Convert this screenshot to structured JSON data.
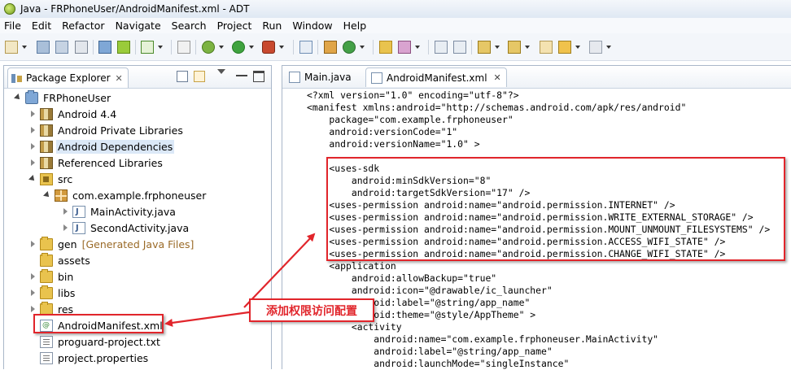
{
  "window": {
    "title": "Java - FRPhoneUser/AndroidManifest.xml - ADT"
  },
  "menu": [
    "File",
    "Edit",
    "Refactor",
    "Navigate",
    "Search",
    "Project",
    "Run",
    "Window",
    "Help"
  ],
  "package_explorer": {
    "tab_label": "Package Explorer",
    "close_glyph": "✕",
    "items": [
      {
        "label": "FRPhoneUser"
      },
      {
        "label": "Android 4.4"
      },
      {
        "label": "Android Private Libraries"
      },
      {
        "label": "Android Dependencies"
      },
      {
        "label": "Referenced Libraries"
      },
      {
        "label": "src"
      },
      {
        "label": "com.example.frphoneuser"
      },
      {
        "label": "MainActivity.java"
      },
      {
        "label": "SecondActivity.java"
      },
      {
        "label": "gen",
        "decoration": "[Generated Java Files]"
      },
      {
        "label": "assets"
      },
      {
        "label": "bin"
      },
      {
        "label": "libs"
      },
      {
        "label": "res"
      },
      {
        "label": "AndroidManifest.xml"
      },
      {
        "label": "proguard-project.txt"
      },
      {
        "label": "project.properties"
      }
    ]
  },
  "editor": {
    "tabs": [
      {
        "label": "Main.java"
      },
      {
        "label": "AndroidManifest.xml",
        "close": "✕"
      }
    ],
    "lines": [
      "<?xml version=\"1.0\" encoding=\"utf-8\"?>",
      "<manifest xmlns:android=\"http://schemas.android.com/apk/res/android\"",
      "    package=\"com.example.frphoneuser\"",
      "    android:versionCode=\"1\"",
      "    android:versionName=\"1.0\" >",
      "",
      "    <uses-sdk",
      "        android:minSdkVersion=\"8\"",
      "        android:targetSdkVersion=\"17\" />",
      "    <uses-permission android:name=\"android.permission.INTERNET\" />",
      "    <uses-permission android:name=\"android.permission.WRITE_EXTERNAL_STORAGE\" />",
      "    <uses-permission android:name=\"android.permission.MOUNT_UNMOUNT_FILESYSTEMS\" />",
      "    <uses-permission android:name=\"android.permission.ACCESS_WIFI_STATE\" />",
      "    <uses-permission android:name=\"android.permission.CHANGE_WIFI_STATE\" />",
      "    <application",
      "        android:allowBackup=\"true\"",
      "        android:icon=\"@drawable/ic_launcher\"",
      "        android:label=\"@string/app_name\"",
      "        android:theme=\"@style/AppTheme\" >",
      "        <activity",
      "            android:name=\"com.example.frphoneuser.MainActivity\"",
      "            android:label=\"@string/app_name\"",
      "            android:launchMode=\"singleInstance\""
    ]
  },
  "annotation": {
    "callout_text": "添加权限访问配置"
  },
  "colors": {
    "highlight": "#e1252b",
    "decoration": "#9a6a27"
  }
}
